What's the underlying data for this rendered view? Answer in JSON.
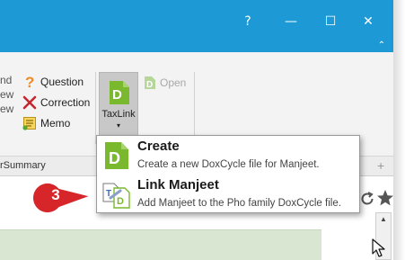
{
  "titlebar": {
    "help_label": "?",
    "minimize_label": "—",
    "maximize_label": "☐",
    "close_label": "✕",
    "collapse_label": "⌃"
  },
  "ribbon": {
    "left_fragments": [
      "nd",
      "ew",
      "ew"
    ],
    "question_label": "Question",
    "correction_label": "Correction",
    "memo_label": "Memo",
    "taxlink_label": "TaxLink",
    "taxlink_arrow": "▾",
    "open_label": "Open"
  },
  "tabstrip": {
    "label": "rSummary",
    "add_label": "+"
  },
  "menu": {
    "items": [
      {
        "title": "Create",
        "desc": "Create a new DoxCycle file for Manjeet."
      },
      {
        "title": "Link Manjeet",
        "desc": "Add Manjeet to the Pho family DoxCycle file."
      }
    ]
  },
  "callout": {
    "number": "3"
  },
  "scrollbar": {
    "up_arrow": "▲"
  },
  "colors": {
    "titlebar": "#1d9ad6",
    "brand_green": "#7ab82e",
    "callout_red": "#d7262a",
    "question_orange": "#f08a24",
    "correction_red": "#c4262e"
  }
}
